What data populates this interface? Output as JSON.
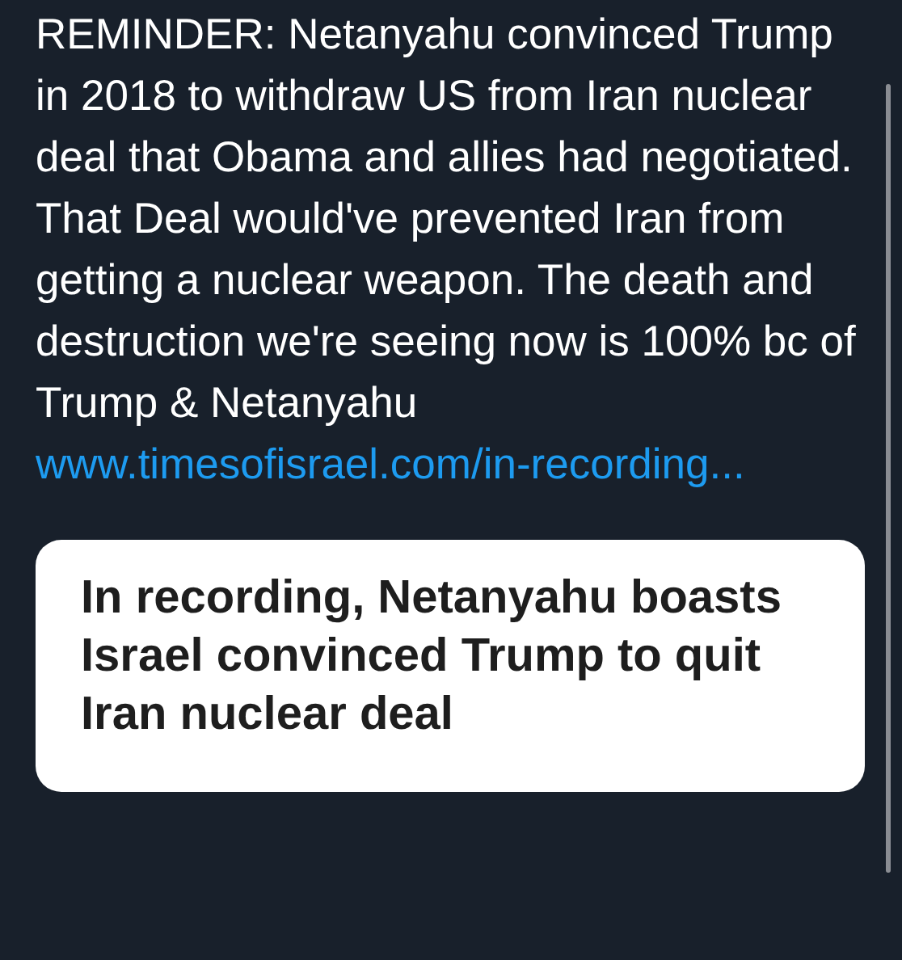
{
  "post": {
    "text": "REMINDER: Netanyahu convinced Trump in 2018 to withdraw US from Iran nuclear deal that Obama and allies had negotiated. That Deal would've prevented Iran from getting a nuclear weapon. The death and destruction we're seeing now is 100% bc of Trump & Netanyahu",
    "link": "www.timesofisrael.com/in-recording..."
  },
  "link_card": {
    "headline": "In recording, Netanyahu boasts Israel convinced Trump to quit Iran nuclear deal"
  }
}
